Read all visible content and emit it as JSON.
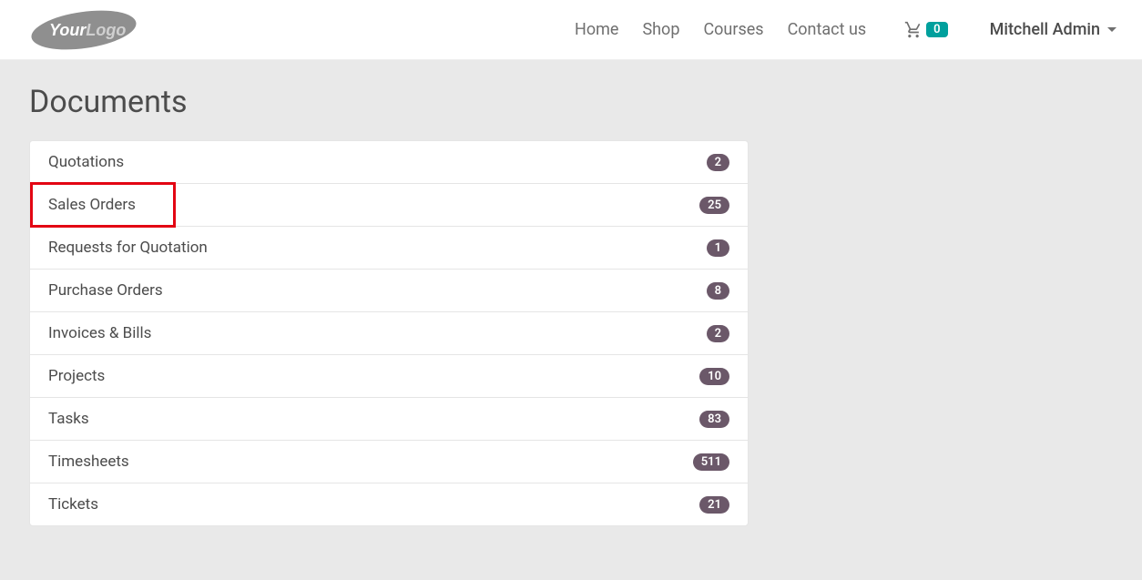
{
  "header": {
    "nav": {
      "home": "Home",
      "shop": "Shop",
      "courses": "Courses",
      "contact": "Contact us"
    },
    "cart_count": "0",
    "user_name": "Mitchell Admin"
  },
  "page_title": "Documents",
  "documents": [
    {
      "label": "Quotations",
      "count": "2",
      "highlighted": false
    },
    {
      "label": "Sales Orders",
      "count": "25",
      "highlighted": true
    },
    {
      "label": "Requests for Quotation",
      "count": "1",
      "highlighted": false
    },
    {
      "label": "Purchase Orders",
      "count": "8",
      "highlighted": false
    },
    {
      "label": "Invoices & Bills",
      "count": "2",
      "highlighted": false
    },
    {
      "label": "Projects",
      "count": "10",
      "highlighted": false
    },
    {
      "label": "Tasks",
      "count": "83",
      "highlighted": false
    },
    {
      "label": "Timesheets",
      "count": "511",
      "highlighted": false
    },
    {
      "label": "Tickets",
      "count": "21",
      "highlighted": false
    }
  ]
}
